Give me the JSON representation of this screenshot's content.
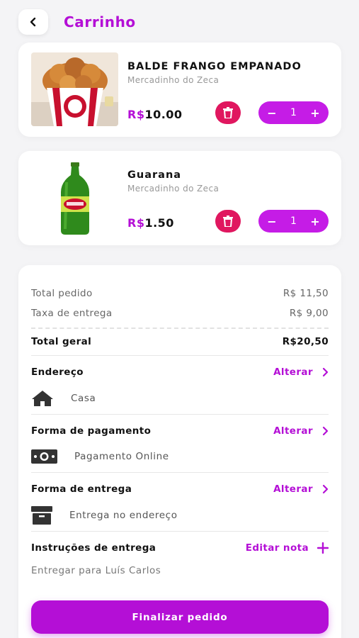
{
  "header": {
    "title": "Carrinho",
    "back_icon": "chevron-left-icon"
  },
  "cart": {
    "currency": "R$",
    "items": [
      {
        "name": "BALDE FRANGO EMPANADO",
        "store": "Mercadinho do Zeca",
        "price": "10.00",
        "quantity": "1"
      },
      {
        "name": "Guarana",
        "store": "Mercadinho do Zeca",
        "price": "1.50",
        "quantity": "1"
      }
    ]
  },
  "summary": {
    "total_pedido_label": "Total pedido",
    "total_pedido_value": "R$ 11,50",
    "taxa_label": "Taxa de entrega",
    "taxa_value": "R$ 9,00",
    "total_geral_label": "Total geral",
    "total_geral_value": "R$20,50"
  },
  "address": {
    "title": "Endereço",
    "action": "Alterar",
    "value": "Casa",
    "icon": "home-icon"
  },
  "payment": {
    "title": "Forma de pagamento",
    "action": "Alterar",
    "value": "Pagamento Online",
    "icon": "cash-icon"
  },
  "delivery": {
    "title": "Forma de entrega",
    "action": "Alterar",
    "value": "Entrega no endereço",
    "icon": "box-icon"
  },
  "instructions": {
    "title": "Instruções de entrega",
    "action": "Editar nota",
    "value": "Entregar para Luís Carlos"
  },
  "footer": {
    "finish_label": "Finalizar pedido"
  },
  "colors": {
    "accent": "#b40fd6",
    "stepper": "#c51ce6",
    "delete": "#e0175f"
  }
}
